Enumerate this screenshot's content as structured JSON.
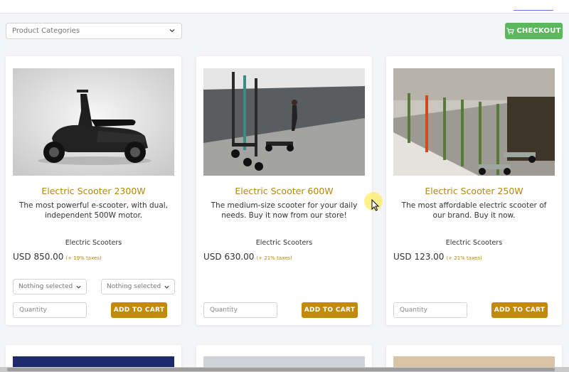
{
  "filters": {
    "category_placeholder": "Product Categories"
  },
  "header": {
    "checkout_label": "CHECKOUT"
  },
  "colors": {
    "accent": "#c38a0a",
    "title": "#b48612",
    "checkout": "#5cb85c"
  },
  "products": [
    {
      "title": "Electric Scooter 2300W",
      "description": "The most powerful e-scooter, with dual, independent 500W motor.",
      "category": "Electric Scooters",
      "price": "USD 850.00",
      "tax": "(+ 19% taxes)",
      "option1": "Nothing selected",
      "option2": "Nothing selected",
      "quantity_placeholder": "Quantity",
      "add_label": "ADD TO CART"
    },
    {
      "title": "Electric Scooter 600W",
      "description": "The medium-size scooter for your daily needs. Buy it now from our store!",
      "category": "Electric Scooters",
      "price": "USD 630.00",
      "tax": "(+ 21% taxes)",
      "quantity_placeholder": "Quantity",
      "add_label": "ADD TO CART"
    },
    {
      "title": "Electric Scooter 250W",
      "description": "The most affordable electric scooter of our brand. Buy it now.",
      "category": "Electric Scooters",
      "price": "USD 123.00",
      "tax": "(+ 21% taxes)",
      "quantity_placeholder": "Quantity",
      "add_label": "ADD TO CART"
    }
  ]
}
